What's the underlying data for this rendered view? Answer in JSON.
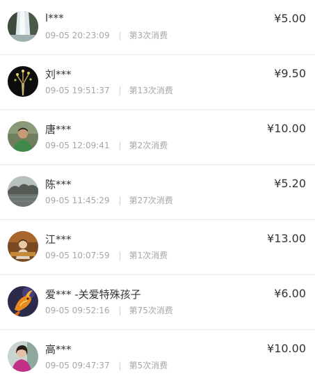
{
  "currency_symbol": "¥",
  "records": [
    {
      "name": "l***",
      "time": "09-05 20:23:09",
      "count": "第3次消费",
      "amount": "5.00",
      "avatar_icon": "waterfall-photo-icon"
    },
    {
      "name": "刘***",
      "time": "09-05 19:51:37",
      "count": "第13次消费",
      "amount": "9.50",
      "avatar_icon": "tree-drawing-icon"
    },
    {
      "name": "唐***",
      "time": "09-05 12:09:41",
      "count": "第2次消费",
      "amount": "10.00",
      "avatar_icon": "person-photo-icon"
    },
    {
      "name": "陈***",
      "time": "09-05 11:45:29",
      "count": "第27次消费",
      "amount": "5.20",
      "avatar_icon": "lake-landscape-icon"
    },
    {
      "name": "江***",
      "time": "09-05 10:07:59",
      "count": "第1次消费",
      "amount": "13.00",
      "avatar_icon": "cartoon-figure-icon"
    },
    {
      "name": "爱*** -关爱特殊孩子",
      "time": "09-05 09:52:16",
      "count": "第75次消费",
      "amount": "6.00",
      "avatar_icon": "koi-fish-icon"
    },
    {
      "name": "高***",
      "time": "09-05 09:47:37",
      "count": "第5次消费",
      "amount": "10.00",
      "avatar_icon": "woman-photo-icon"
    }
  ]
}
